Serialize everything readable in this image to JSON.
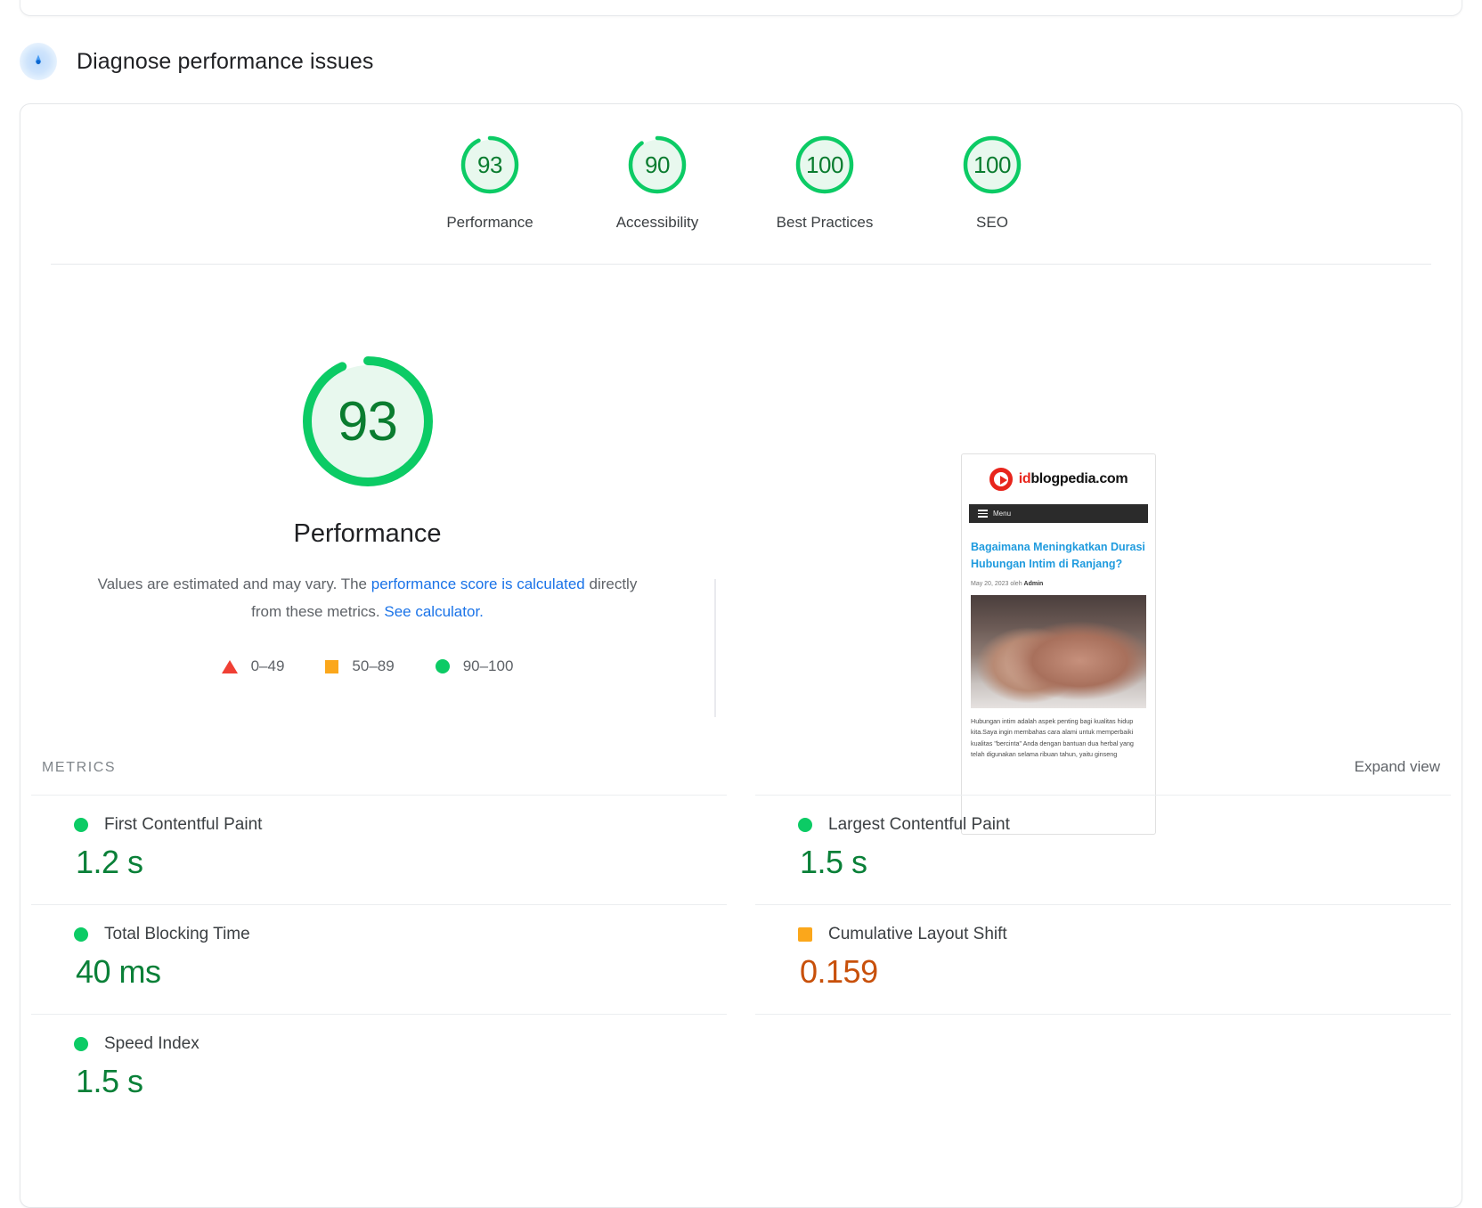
{
  "top_card_stub": {
    "present": true
  },
  "section": {
    "icon": "lighthouse-icon",
    "title": "Diagnose performance issues"
  },
  "category_scores": [
    {
      "value": "93",
      "label": "Performance",
      "percent": 93,
      "color": "#0ccb65"
    },
    {
      "value": "90",
      "label": "Accessibility",
      "percent": 90,
      "color": "#0ccb65"
    },
    {
      "value": "100",
      "label": "Best Practices",
      "percent": 100,
      "color": "#0ccb65"
    },
    {
      "value": "100",
      "label": "SEO",
      "percent": 100,
      "color": "#0ccb65"
    }
  ],
  "hero": {
    "score": "93",
    "category": "Performance",
    "desc_part1": "Values are estimated and may vary. The ",
    "desc_link1": "performance score is calculated",
    "desc_part2": " directly from these metrics. ",
    "desc_link2": "See calculator.",
    "legend": [
      {
        "shape": "triangle",
        "range": "0–49",
        "color": "#f03f34"
      },
      {
        "shape": "square",
        "range": "50–89",
        "color": "#fba71b"
      },
      {
        "shape": "circle",
        "range": "90–100",
        "color": "#0ccb65"
      }
    ]
  },
  "thumbnail": {
    "logo_red": "id",
    "logo_dark": "blogpedia.com",
    "menu_label": "Menu",
    "headline": "Bagaimana Meningkatkan Durasi Hubungan Intim di Ranjang?",
    "byline_date": "May 20, 2023 oleh ",
    "byline_author": "Admin",
    "body": "Hubungan intim adalah aspek penting bagi kualitas hidup kita.Saya ingin membahas cara alami untuk memperbaiki kualitas \"bercinta\" Anda dengan bantuan dua herbal yang telah digunakan selama ribuan tahun, yaitu ginseng"
  },
  "metrics_section": {
    "title": "METRICS",
    "expand_label": "Expand view",
    "items": [
      {
        "name": "First Contentful Paint",
        "value": "1.2 s",
        "status": "green",
        "shape": "circle"
      },
      {
        "name": "Largest Contentful Paint",
        "value": "1.5 s",
        "status": "green",
        "shape": "circle"
      },
      {
        "name": "Total Blocking Time",
        "value": "40 ms",
        "status": "green",
        "shape": "circle"
      },
      {
        "name": "Cumulative Layout Shift",
        "value": "0.159",
        "status": "orange",
        "shape": "square"
      },
      {
        "name": "Speed Index",
        "value": "1.5 s",
        "status": "green",
        "shape": "circle"
      }
    ]
  },
  "colors": {
    "green": "#0ccb65",
    "green_text": "#0a8038",
    "orange": "#fba71b",
    "orange_text": "#c8500a",
    "red": "#f03f34",
    "link": "#1a73e8"
  }
}
